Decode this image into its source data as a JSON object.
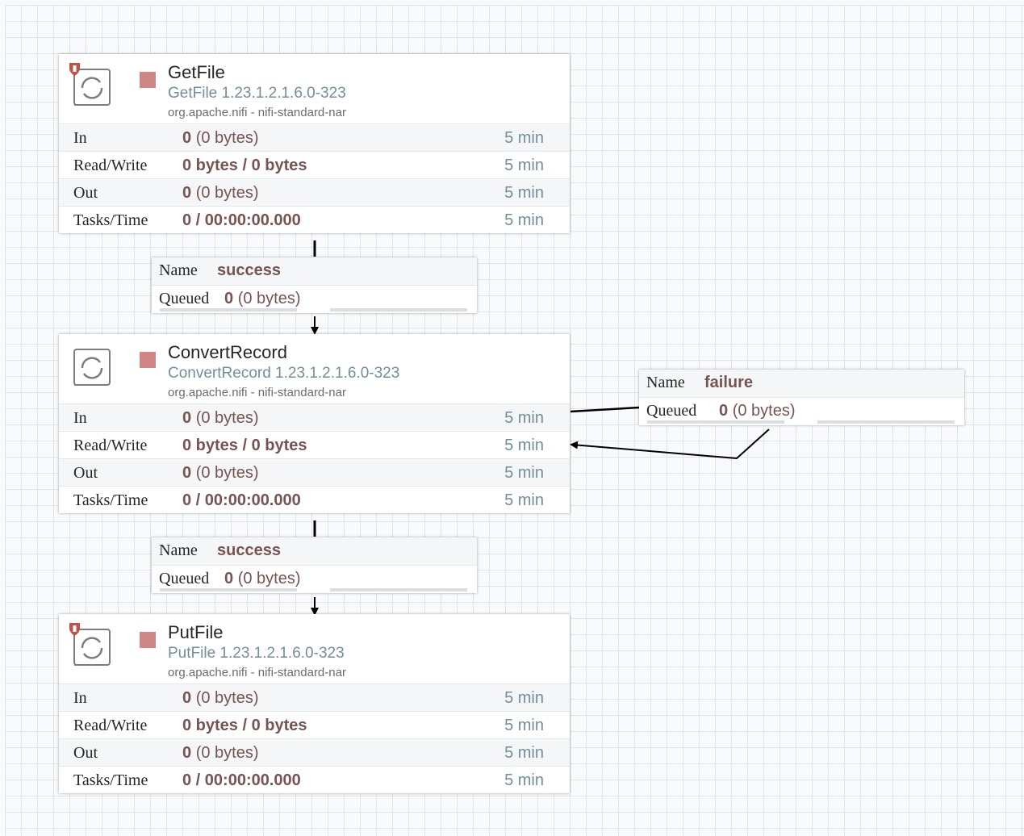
{
  "processors": [
    {
      "name": "GetFile",
      "type": "GetFile 1.23.1.2.1.6.0-323",
      "bundle": "org.apache.nifi - nifi-standard-nar",
      "restricted": true,
      "stats": {
        "in_label": "In",
        "in_value": "0",
        "in_sub": "(0 bytes)",
        "in_time": "5 min",
        "rw_label": "Read/Write",
        "rw_value": "0 bytes / 0 bytes",
        "rw_time": "5 min",
        "out_label": "Out",
        "out_value": "0",
        "out_sub": "(0 bytes)",
        "out_time": "5 min",
        "tasks_label": "Tasks/Time",
        "tasks_value": "0 / 00:00:00.000",
        "tasks_time": "5 min"
      }
    },
    {
      "name": "ConvertRecord",
      "type": "ConvertRecord 1.23.1.2.1.6.0-323",
      "bundle": "org.apache.nifi - nifi-standard-nar",
      "restricted": false,
      "stats": {
        "in_label": "In",
        "in_value": "0",
        "in_sub": "(0 bytes)",
        "in_time": "5 min",
        "rw_label": "Read/Write",
        "rw_value": "0 bytes / 0 bytes",
        "rw_time": "5 min",
        "out_label": "Out",
        "out_value": "0",
        "out_sub": "(0 bytes)",
        "out_time": "5 min",
        "tasks_label": "Tasks/Time",
        "tasks_value": "0 / 00:00:00.000",
        "tasks_time": "5 min"
      }
    },
    {
      "name": "PutFile",
      "type": "PutFile 1.23.1.2.1.6.0-323",
      "bundle": "org.apache.nifi - nifi-standard-nar",
      "restricted": true,
      "stats": {
        "in_label": "In",
        "in_value": "0",
        "in_sub": "(0 bytes)",
        "in_time": "5 min",
        "rw_label": "Read/Write",
        "rw_value": "0 bytes / 0 bytes",
        "rw_time": "5 min",
        "out_label": "Out",
        "out_value": "0",
        "out_sub": "(0 bytes)",
        "out_time": "5 min",
        "tasks_label": "Tasks/Time",
        "tasks_value": "0 / 00:00:00.000",
        "tasks_time": "5 min"
      }
    }
  ],
  "connections": [
    {
      "name_key": "Name",
      "name": "success",
      "queued_key": "Queued",
      "queued": "0",
      "queued_sub": "(0 bytes)"
    },
    {
      "name_key": "Name",
      "name": "failure",
      "queued_key": "Queued",
      "queued": "0",
      "queued_sub": "(0 bytes)"
    },
    {
      "name_key": "Name",
      "name": "success",
      "queued_key": "Queued",
      "queued": "0",
      "queued_sub": "(0 bytes)"
    }
  ],
  "colors": {
    "stopped_state": "#d18686",
    "processor_type": "#728e9b",
    "stat_value": "#775351",
    "grid_line": "#dde4ea"
  },
  "icons": {
    "processor": "processor-gear-icon",
    "restricted": "restricted-shield-icon",
    "state": "stopped-square-icon"
  }
}
